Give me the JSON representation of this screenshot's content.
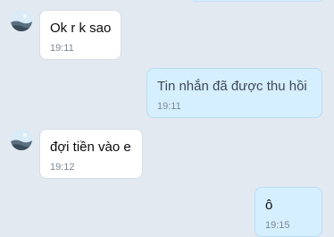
{
  "chat": {
    "messages": [
      {
        "direction": "incoming",
        "text": "Ok r k sao",
        "time": "19:11"
      },
      {
        "direction": "outgoing",
        "text": "Tin nhắn đã được thu hồi",
        "time": "19:11",
        "recalled": true
      },
      {
        "direction": "incoming",
        "text": "đợi tiền vào e",
        "time": "19:12"
      },
      {
        "direction": "outgoing",
        "text": "ô",
        "time": "19:15"
      }
    ]
  },
  "colors": {
    "background": "#e2e9f1",
    "incoming_bubble": "#ffffff",
    "outgoing_bubble": "#d5effe",
    "time_text": "#7b8795"
  },
  "icons": {
    "avatar": "contact-avatar-icon"
  }
}
